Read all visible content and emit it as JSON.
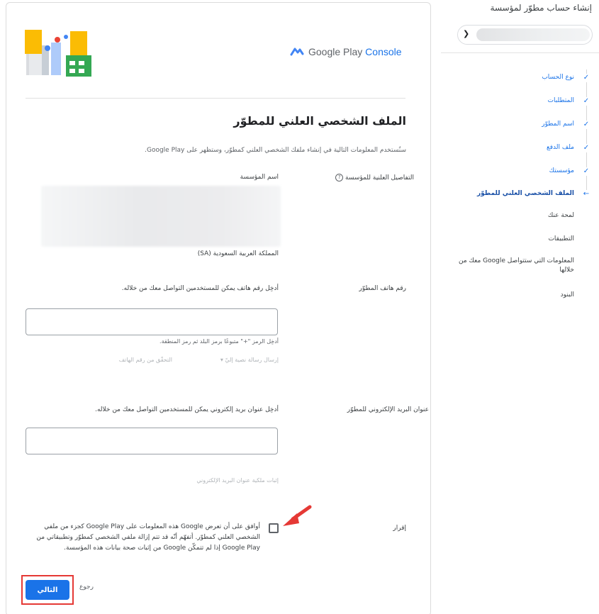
{
  "sidebar": {
    "title": "إنشاء حساب مطوّر لمؤسسة",
    "steps": [
      {
        "label": "نوع الحساب",
        "state": "done"
      },
      {
        "label": "المتطلبات",
        "state": "done"
      },
      {
        "label": "اسم المطوّر",
        "state": "done"
      },
      {
        "label": "ملف الدفع",
        "state": "done"
      },
      {
        "label": "مؤسستك",
        "state": "done"
      },
      {
        "label": "الملف الشخصي العلني للمطوّر",
        "state": "current"
      },
      {
        "label": "لمحة عنك",
        "state": "pending"
      },
      {
        "label": "التطبيقات",
        "state": "pending"
      },
      {
        "label": "المعلومات التي ستتواصل Google معك من خلالها",
        "state": "pending"
      },
      {
        "label": "البنود",
        "state": "pending"
      }
    ],
    "done_mark": "✓",
    "current_mark": "←",
    "select_icon": "chevron-down-icon"
  },
  "header": {
    "logo_google": "Google Play",
    "logo_console": "Console"
  },
  "main": {
    "title": "الملف الشخصي العلني للمطوّر",
    "intro": "سنُستخدم المعلومات التالية في إنشاء ملفك الشخصي العلني كمطوّر، وستظهر على Google Play.",
    "org_details_label": "التفاصيل العلنية للمؤسسة",
    "help_icon": "?",
    "org_name_label": "اسم المؤسسة",
    "country": "المملكة العربية السعودية (SA)",
    "phone": {
      "section_label": "رقم هاتف المطوّر",
      "description": "أدخِل رقم هاتف يمكن للمستخدمين التواصل معك من خلاله.",
      "value": "",
      "hint": "أدخِل الرمز \"+\" متبوعًا برمز البلد ثم رمز المنطقة.",
      "send_sms": "إرسال رسالة نصية إليّ",
      "verify": "التحقّق من رقم الهاتف"
    },
    "email": {
      "section_label": "عنوان البريد الإلكتروني للمطوّر",
      "description": "أدخِل عنوان بريد إلكتروني يمكن للمستخدمين التواصل معك من خلاله.",
      "value": "",
      "verify": "إثبات ملكية عنوان البريد الإلكتروني"
    },
    "consent": {
      "label": "إقرار",
      "text": "أوافق على أن تعرض Google هذه المعلومات على Google Play كجزء من ملفي الشخصي العلني كمطوّر. أتفهّم أنّه قد تتم إزالة ملفي الشخصي كمطوّر وتطبيقاتي من Google Play إذا لم تتمكّن Google من إثبات صحة بيانات هذه المؤسسة."
    },
    "next_label": "التالي",
    "back_label": "رجوع"
  },
  "colors": {
    "primary": "#1a73e8",
    "annotation": "#e53935"
  }
}
